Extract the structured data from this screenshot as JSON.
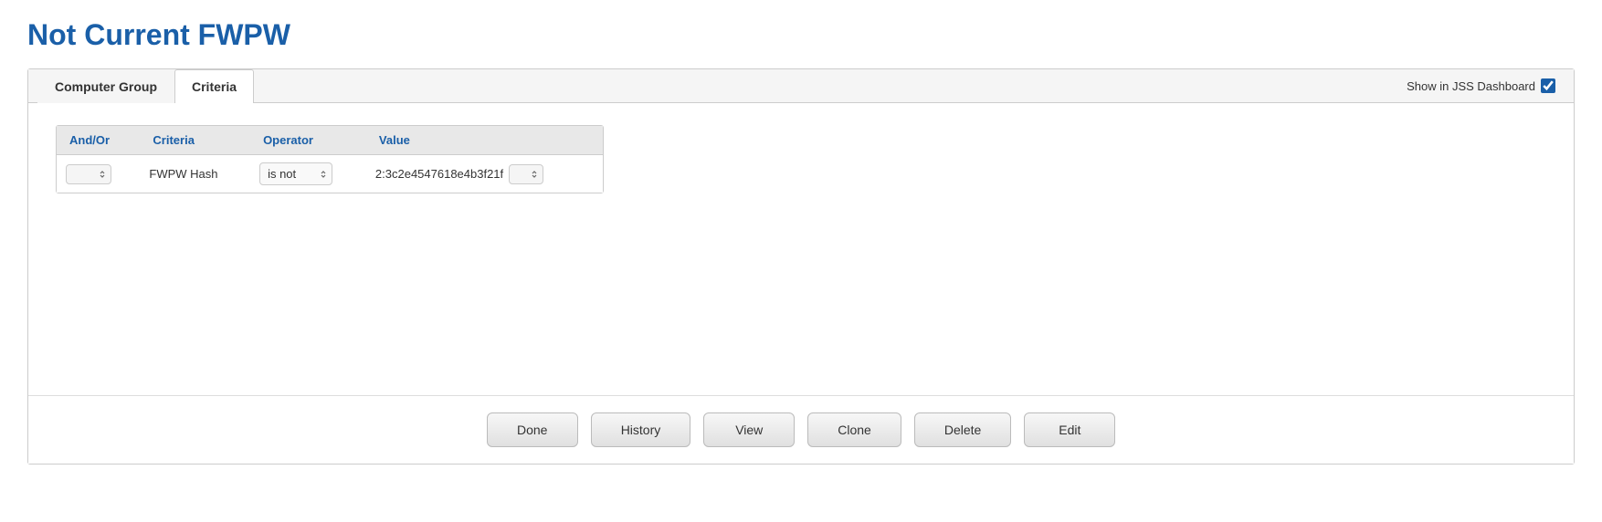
{
  "page": {
    "title": "Not Current FWPW"
  },
  "tabs": [
    {
      "id": "computer-group",
      "label": "Computer Group",
      "active": false
    },
    {
      "id": "criteria",
      "label": "Criteria",
      "active": true
    }
  ],
  "dashboard": {
    "label": "Show in JSS Dashboard",
    "checked": true
  },
  "criteria_table": {
    "headers": [
      {
        "id": "and-or",
        "label": "And/Or"
      },
      {
        "id": "criteria",
        "label": "Criteria"
      },
      {
        "id": "operator",
        "label": "Operator"
      },
      {
        "id": "value",
        "label": "Value"
      }
    ],
    "rows": [
      {
        "and_or": "",
        "criteria_name": "FWPW Hash",
        "operator": "is not",
        "value": "2:3c2e4547618e4b3f21f"
      }
    ]
  },
  "footer_buttons": [
    {
      "id": "done",
      "label": "Done"
    },
    {
      "id": "history",
      "label": "History"
    },
    {
      "id": "view",
      "label": "View"
    },
    {
      "id": "clone",
      "label": "Clone"
    },
    {
      "id": "delete",
      "label": "Delete"
    },
    {
      "id": "edit",
      "label": "Edit"
    }
  ]
}
